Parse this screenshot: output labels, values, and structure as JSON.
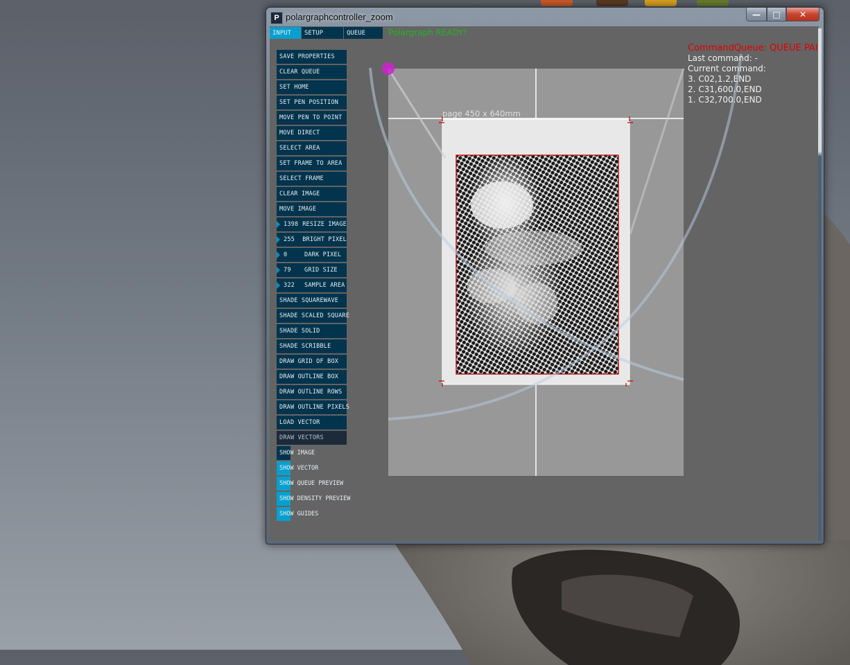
{
  "desktop": {
    "taskbar_icon_colors": [
      "#c85a2a",
      "#5a3a22",
      "#d8a020",
      "#6a7a30"
    ]
  },
  "window": {
    "title": "polargraphcontroller_zoom",
    "app_icon_glyph": "P",
    "controls": {
      "minimize_glyph": "—",
      "maximize_glyph": "□",
      "close_glyph": "✕"
    }
  },
  "tabs": [
    {
      "label": "INPUT",
      "active": true
    },
    {
      "label": "SETUP",
      "active": false
    },
    {
      "label": "QUEUE",
      "active": false
    }
  ],
  "status": {
    "text": "Polargraph READY!",
    "color": "#22b422"
  },
  "buttons": [
    {
      "label": "SAVE PROPERTIES"
    },
    {
      "label": "CLEAR QUEUE"
    },
    {
      "label": "SET HOME"
    },
    {
      "label": "SET PEN POSITION"
    },
    {
      "label": "MOVE PEN TO POINT"
    },
    {
      "label": "MOVE DIRECT"
    },
    {
      "label": "SELECT AREA"
    },
    {
      "label": "SET FRAME TO AREA"
    },
    {
      "label": "SELECT FRAME"
    },
    {
      "label": "CLEAR IMAGE"
    },
    {
      "label": "MOVE IMAGE"
    }
  ],
  "numeric_controls": [
    {
      "value": "1398",
      "label": "RESIZE IMAGE"
    },
    {
      "value": "255",
      "label": "BRIGHT PIXEL"
    },
    {
      "value": "0",
      "label": "DARK PIXEL"
    },
    {
      "value": "79",
      "label": "GRID SIZE"
    },
    {
      "value": "322",
      "label": "SAMPLE AREA"
    }
  ],
  "buttons2": [
    {
      "label": "SHADE SQUAREWAVE"
    },
    {
      "label": "SHADE SCALED SQUARE"
    },
    {
      "label": "SHADE SOLID"
    },
    {
      "label": "SHADE SCRIBBLE"
    },
    {
      "label": "DRAW GRID OF BOX"
    },
    {
      "label": "DRAW OUTLINE BOX"
    },
    {
      "label": "DRAW OUTLINE ROWS"
    },
    {
      "label": "DRAW OUTLINE PIXELS"
    },
    {
      "label": "LOAD VECTOR"
    },
    {
      "label": "DRAW VECTORS",
      "disabled": true
    }
  ],
  "toggles": [
    {
      "label": "SHOW IMAGE",
      "on": false
    },
    {
      "label": "SHOW VECTOR",
      "on": true
    },
    {
      "label": "SHOW QUEUE PREVIEW",
      "on": true
    },
    {
      "label": "SHOW DENSITY PREVIEW",
      "on": true
    },
    {
      "label": "SHOW GUIDES",
      "on": true
    }
  ],
  "canvas": {
    "page_label": "page 450 x 640mm",
    "pen_marker_color": "#d020d0",
    "frame_color": "#c00000"
  },
  "queue": {
    "title": "CommandQueue: QUEUE PAI",
    "last_command": "Last command: -",
    "current_command": "Current command:",
    "items": [
      "3. C02,1.2,END",
      "2. C31,600.0,END",
      "1. C32,700.0,END"
    ]
  }
}
